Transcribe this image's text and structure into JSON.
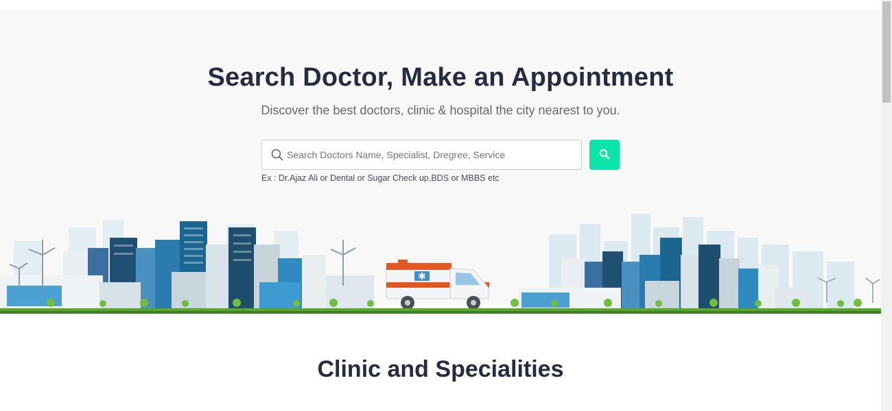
{
  "hero": {
    "title": "Search Doctor, Make an Appointment",
    "subtitle": "Discover the best doctors, clinic & hospital the city nearest to you.",
    "search": {
      "placeholder": "Search Doctors Name, Specialist, Dregree, Service",
      "value": "",
      "hint": "Ex : Dr.Ajaz Ali or Dental or Sugar Check up,BDS or MBBS etc",
      "button_icon": "search-icon"
    },
    "illustration": "cityscape-with-ambulance"
  },
  "section": {
    "title": "Clinic and Specialities"
  },
  "colors": {
    "accent": "#09e5ab",
    "heading": "#272b41",
    "hero_bg": "#f8f8f8"
  }
}
